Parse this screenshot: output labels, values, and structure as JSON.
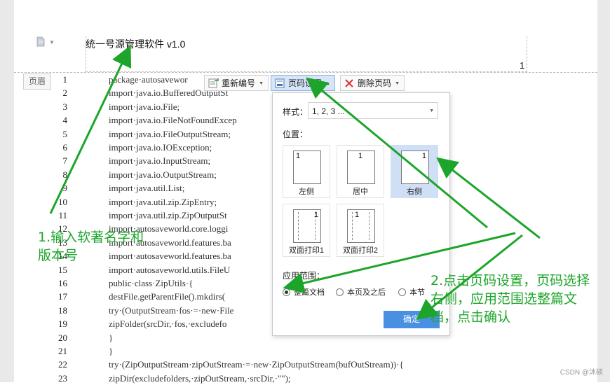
{
  "header": {
    "text": "统一号源管理软件 v1.0",
    "page_number": "1",
    "tag": "页眉"
  },
  "code_lines": [
    {
      "n": "1",
      "t": "package·autosavewor"
    },
    {
      "n": "2",
      "t": "import·java.io.BufferedOutputSt"
    },
    {
      "n": "3",
      "t": "import·java.io.File;"
    },
    {
      "n": "4",
      "t": "import·java.io.FileNotFoundExcep"
    },
    {
      "n": "5",
      "t": "import·java.io.FileOutputStream;"
    },
    {
      "n": "6",
      "t": "import·java.io.IOException;"
    },
    {
      "n": "7",
      "t": "import·java.io.InputStream;"
    },
    {
      "n": "8",
      "t": "import·java.io.OutputStream;"
    },
    {
      "n": "9",
      "t": "import·java.util.List;"
    },
    {
      "n": "10",
      "t": "import·java.util.zip.ZipEntry;"
    },
    {
      "n": "11",
      "t": "import·java.util.zip.ZipOutputSt"
    },
    {
      "n": "12",
      "t": "import·autosaveworld.core.loggi"
    },
    {
      "n": "13",
      "t": "import·autosaveworld.features.ba"
    },
    {
      "n": "14",
      "t": "import·autosaveworld.features.ba"
    },
    {
      "n": "15",
      "t": "import·autosaveworld.utils.FileU"
    },
    {
      "n": "16",
      "t": "public·class·ZipUtils·{"
    },
    {
      "n": "17",
      "t": "destFile.getParentFile().mkdirs("
    },
    {
      "n": "18",
      "t": "try·(OutputStream·fos·=·new·File"
    },
    {
      "n": "19",
      "t": "zipFolder(srcDir,·fos,·excludefo"
    },
    {
      "n": "20",
      "t": "}"
    },
    {
      "n": "21",
      "t": "}"
    },
    {
      "n": "22",
      "t": "try·(ZipOutputStream·zipOutStream·=·new·ZipOutputStream(bufOutStream))·{"
    },
    {
      "n": "23",
      "t": "zipDir(excludefolders,·zipOutStream,·srcDir,·\"\");"
    }
  ],
  "toolbar": {
    "renumber": "重新编号",
    "page_setup": "页码设置",
    "delete_page_number": "删除页码",
    "icons": [
      "renumber-icon",
      "page-setup-icon",
      "delete-x-icon"
    ]
  },
  "panel": {
    "style_label": "样式：",
    "style_value": "1, 2, 3 ...",
    "position_label": "位置：",
    "positions": [
      "左侧",
      "居中",
      "右侧",
      "双面打印1",
      "双面打印2"
    ],
    "selected_position": "右侧",
    "apply_label": "应用范围：",
    "apply_options": [
      "整篇文档",
      "本页及之后",
      "本节"
    ],
    "selected_apply": "整篇文档",
    "ok": "确定"
  },
  "annotations": {
    "step1_line1": "1.输入软著名字和",
    "step1_line2": "版本号",
    "step2_line1": "2.点击页码设置，页码选择",
    "step2_line2": "右侧，应用范围选整篇文",
    "step2_line3": "档，点击确认",
    "arrow_color": "#1ca52a"
  },
  "watermark": "CSDN @沐硕"
}
